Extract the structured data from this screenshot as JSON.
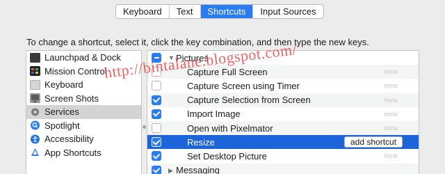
{
  "tabs": [
    "Keyboard",
    "Text",
    "Shortcuts",
    "Input Sources"
  ],
  "active_tab": "Shortcuts",
  "instructions": "To change a shortcut, select it, click the key combination, and then type the new keys.",
  "categories": [
    {
      "label": "Launchpad & Dock",
      "icon": "launchpad-dock-icon",
      "color": "#3b3b3b"
    },
    {
      "label": "Mission Control",
      "icon": "mission-control-icon",
      "color": "#222222"
    },
    {
      "label": "Keyboard",
      "icon": "keyboard-icon",
      "color": "#c8c8c8"
    },
    {
      "label": "Screen Shots",
      "icon": "screen-shots-icon",
      "color": "#8a8a8a"
    },
    {
      "label": "Services",
      "icon": "gear-icon",
      "color": "#7a7a7a"
    },
    {
      "label": "Spotlight",
      "icon": "spotlight-icon",
      "color": "#2a7cf4"
    },
    {
      "label": "Accessibility",
      "icon": "accessibility-icon",
      "color": "#1e74e8"
    },
    {
      "label": "App Shortcuts",
      "icon": "app-shortcuts-icon",
      "color": "#2a7cf4"
    }
  ],
  "selected_category": "Services",
  "shortcuts": {
    "pictures_group": "Pictures",
    "items": [
      {
        "label": "Capture Full Screen",
        "checked": false,
        "key": "none"
      },
      {
        "label": "Capture Screen using Timer",
        "checked": false,
        "key": "none"
      },
      {
        "label": "Capture Selection from Screen",
        "checked": true,
        "key": "none"
      },
      {
        "label": "Import Image",
        "checked": true,
        "key": "none"
      },
      {
        "label": "Open with Pixelmator",
        "checked": false,
        "key": "none"
      },
      {
        "label": "Resize",
        "checked": true,
        "key": "add shortcut"
      },
      {
        "label": "Set Desktop Picture",
        "checked": true,
        "key": "none"
      }
    ],
    "messaging_group": "Messaging"
  },
  "watermark": "http://bintalane.blogspot.com/",
  "colors": {
    "accent": "#2a7cf4",
    "highlight_row": "#1c64d9",
    "watermark": "#e43232"
  }
}
